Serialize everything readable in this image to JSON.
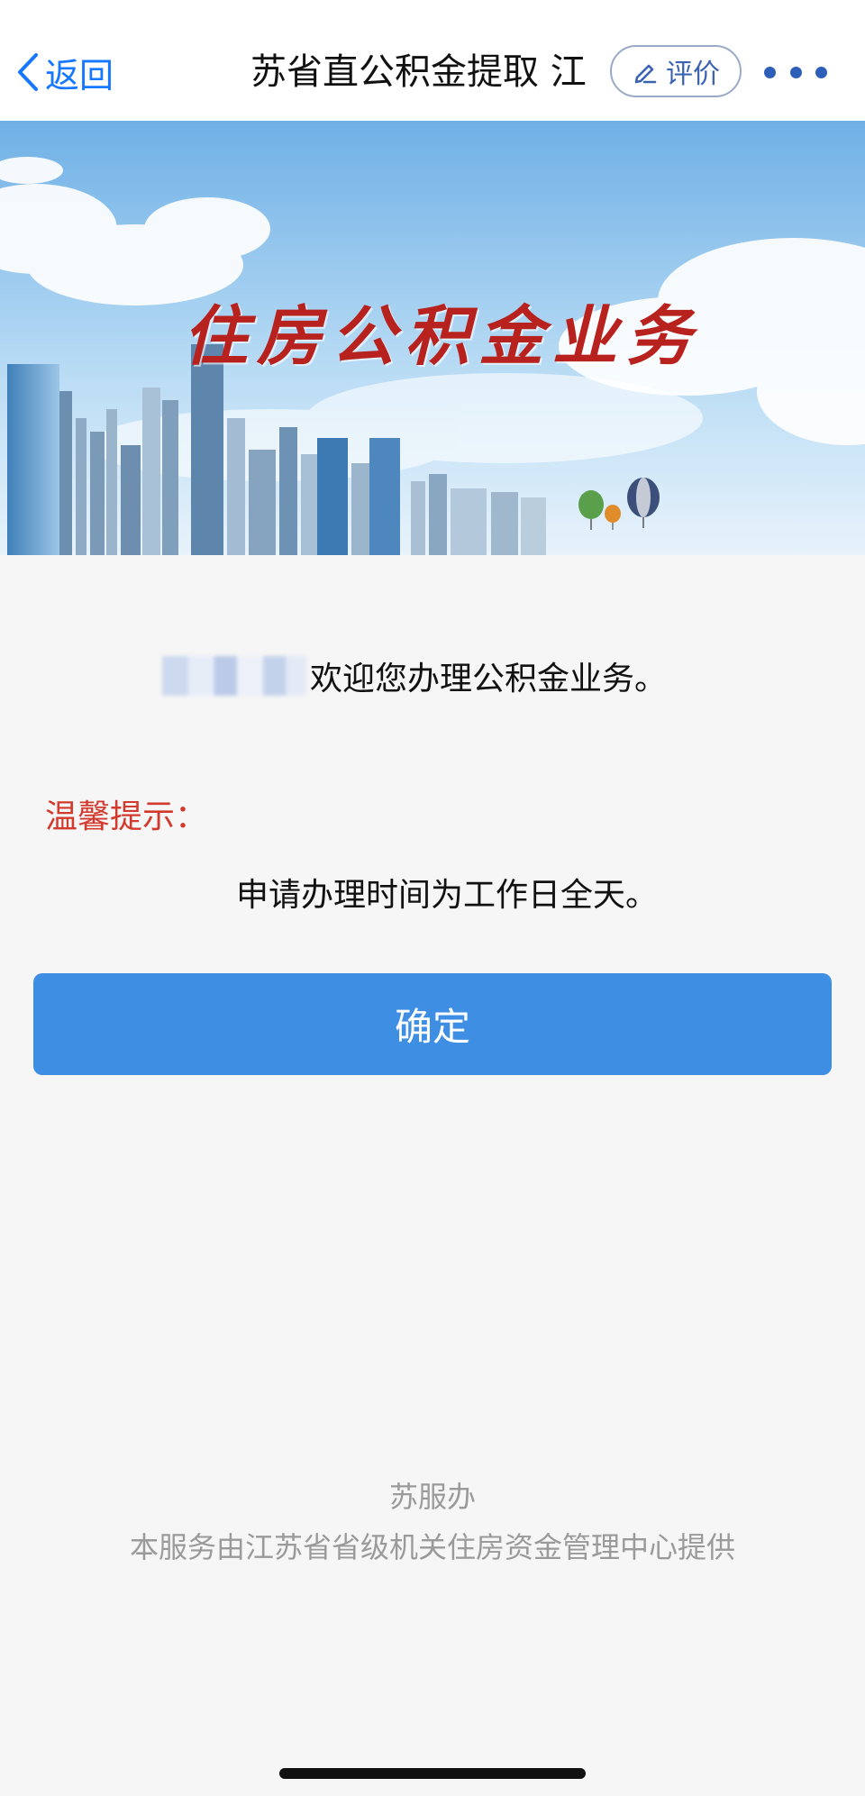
{
  "header": {
    "back_label": "返回",
    "title": "苏省直公积金提取 江",
    "rate_label": "评价"
  },
  "banner": {
    "title": "住房公积金业务"
  },
  "content": {
    "welcome_text": "欢迎您办理公积金业务。",
    "tip_label": "温馨提示：",
    "tip_text": "申请办理时间为工作日全天。",
    "confirm_label": "确定"
  },
  "footer": {
    "brand": "苏服办",
    "provider": "本服务由江苏省省级机关住房资金管理中心提供"
  },
  "colors": {
    "accent": "#3e8ee4",
    "link": "#1677ff",
    "tip": "#d23a2e",
    "banner_title": "#b8221e"
  },
  "icons": {
    "back": "chevron-left-icon",
    "rate": "pencil-icon",
    "more": "more-dots-icon"
  }
}
